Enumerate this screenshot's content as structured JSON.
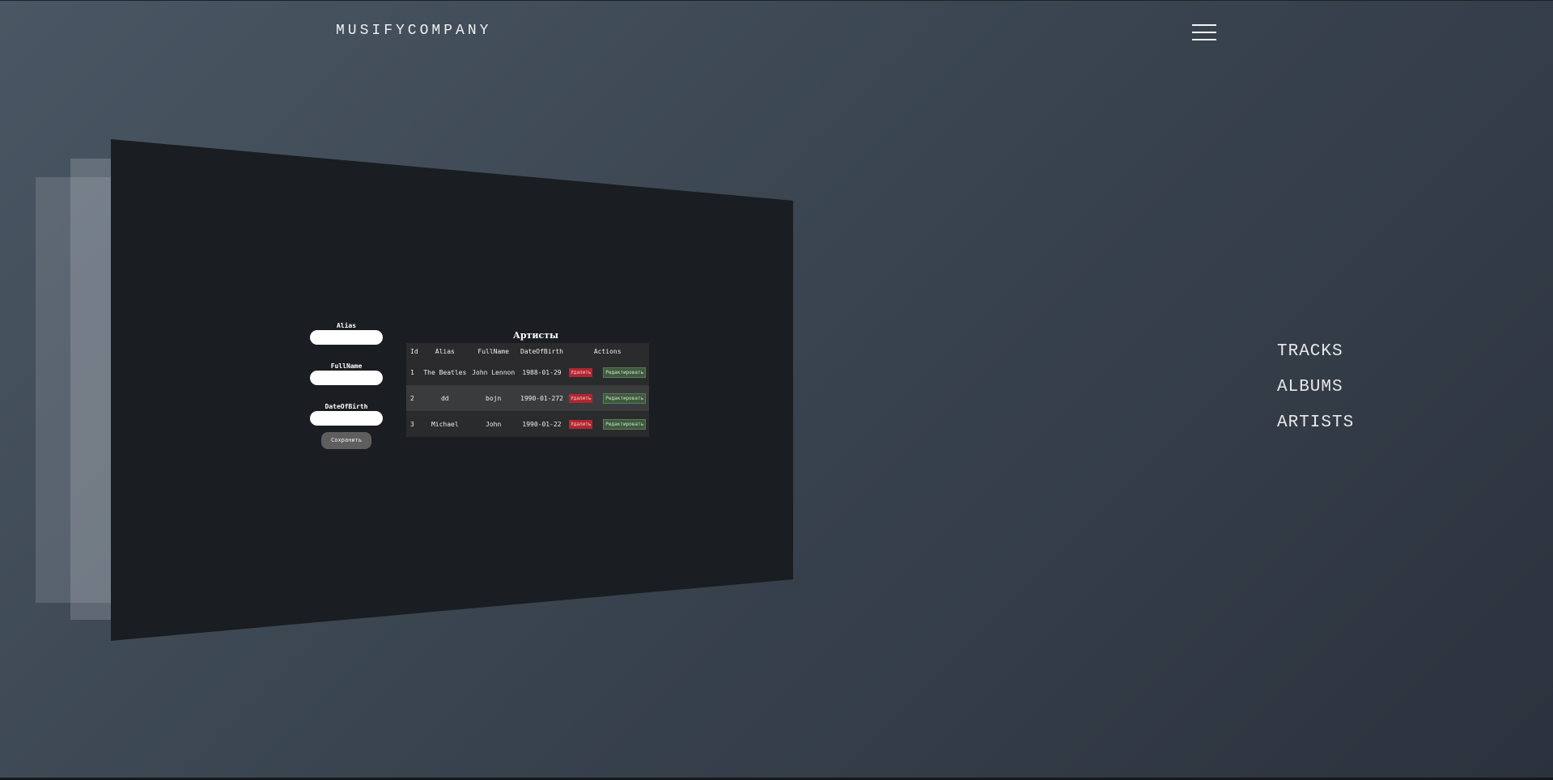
{
  "header": {
    "logo": "MUSIFYCOMPANY"
  },
  "nav": {
    "items": [
      "TRACKS",
      "ALBUMS",
      "ARTISTS"
    ]
  },
  "form": {
    "alias_label": "Alias",
    "fullname_label": "FullName",
    "dob_label": "DateOfBirth",
    "save_label": "Сохранить"
  },
  "table": {
    "title": "Артисты",
    "headers": [
      "Id",
      "Alias",
      "FullName",
      "DateOfBirth",
      "Actions"
    ],
    "rows": [
      {
        "id": "1",
        "alias": "The Beatles",
        "fullname": "John Lennon",
        "dob": "1988-01-29"
      },
      {
        "id": "2",
        "alias": "dd",
        "fullname": "bojn",
        "dob": "1990-01-272"
      },
      {
        "id": "3",
        "alias": "Michael",
        "fullname": "John",
        "dob": "1990-01-22"
      }
    ],
    "delete_label": "Удалить",
    "edit_label": "Редактировать"
  },
  "colors": {
    "panel": "#1a1d21",
    "delete": "#b3262f",
    "edit": "#3d5a3d"
  }
}
